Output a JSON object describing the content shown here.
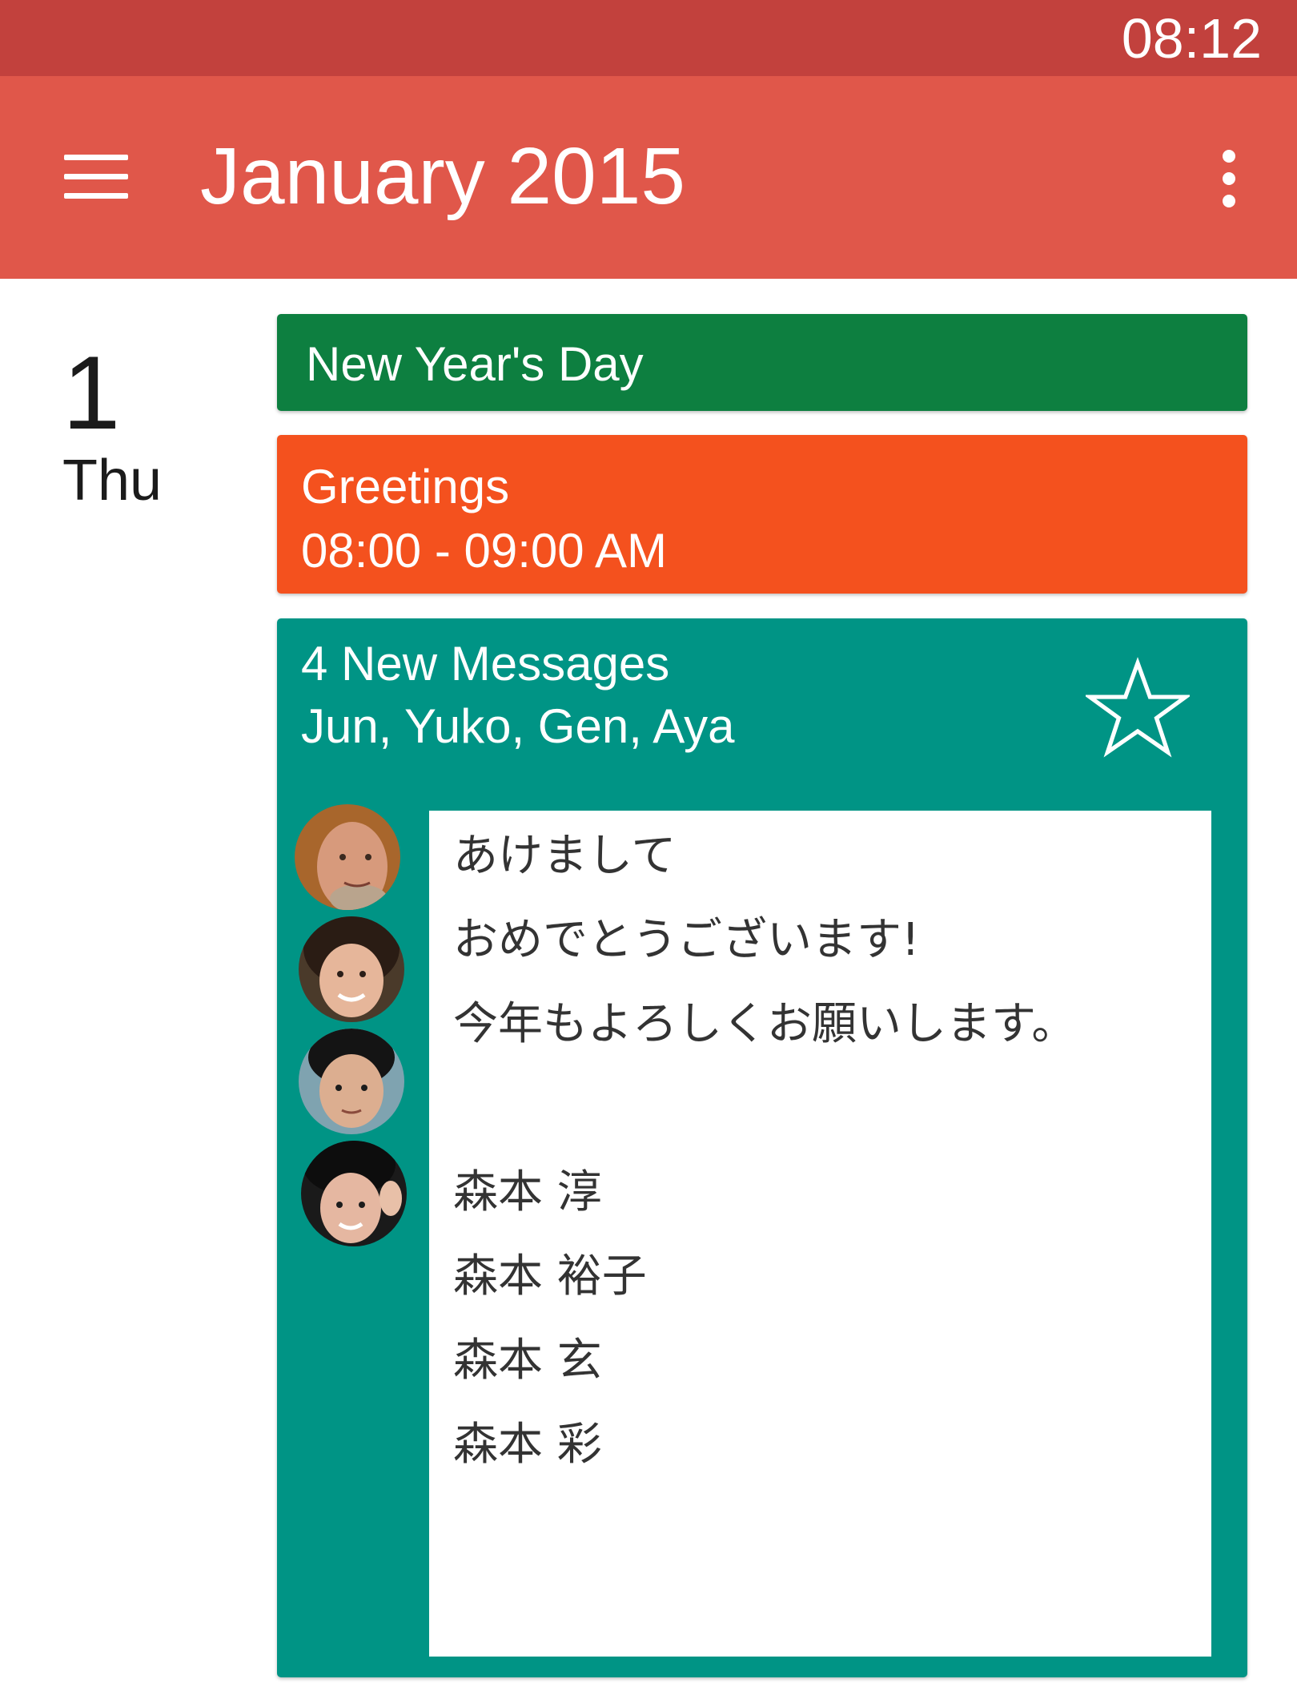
{
  "status_bar": {
    "time": "08:12"
  },
  "app_bar": {
    "title": "January 2015"
  },
  "day": {
    "number": "1",
    "weekday": "Thu"
  },
  "events": {
    "holiday": {
      "title": "New Year's Day",
      "color": "#0d7f40"
    },
    "greetings": {
      "title": "Greetings",
      "time": "08:00 - 09:00 AM",
      "color": "#f4511e"
    },
    "messages": {
      "title": "4 New Messages",
      "senders": "Jun, Yuko, Gen, Aya",
      "color": "#009485",
      "body_lines": [
        "あけまして",
        "おめでとうございます!",
        "今年もよろしくお願いします。",
        "",
        "森本 淳",
        "森本 裕子",
        "森本 玄",
        "森本 彩"
      ]
    }
  },
  "colors": {
    "status_bar": "#c2413d",
    "app_bar": "#e0574a"
  }
}
